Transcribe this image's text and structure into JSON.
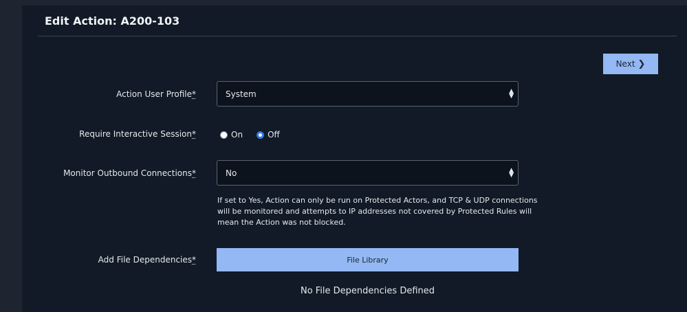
{
  "page": {
    "title": "Edit Action: A200-103"
  },
  "toolbar": {
    "next_label": "Next"
  },
  "form": {
    "user_profile": {
      "label": "Action User Profile",
      "required_mark": "*",
      "value": "System"
    },
    "interactive_session": {
      "label": "Require Interactive Session",
      "required_mark": "*",
      "options": [
        {
          "label": "On",
          "selected": false
        },
        {
          "label": "Off",
          "selected": true
        }
      ]
    },
    "outbound_connections": {
      "label": "Monitor Outbound Connections",
      "required_mark": "*",
      "value": "No",
      "help": "If set to Yes, Action can only be run on Protected Actors, and TCP & UDP connections will be monitored and attempts to IP addresses not covered by Protected Rules will mean the Action was not blocked."
    },
    "file_dependencies": {
      "label": "Add File Dependencies",
      "required_mark": "*",
      "button_label": "File Library",
      "empty_text": "No File Dependencies Defined"
    }
  },
  "colors": {
    "accent_button": "#93b8f3",
    "panel_bg": "#111a26",
    "radio_selected": "#2f7be5"
  }
}
